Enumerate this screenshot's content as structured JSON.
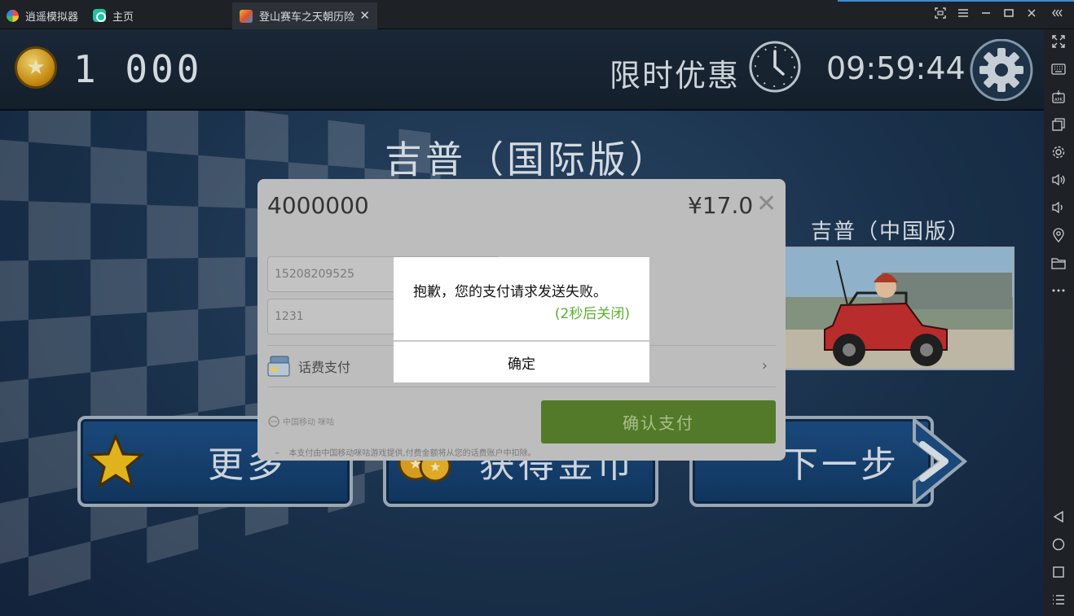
{
  "titlebar": {
    "tabs": [
      {
        "label": "逍遥模拟器"
      },
      {
        "label": "主页"
      },
      {
        "label": "登山赛车之天朝历险"
      }
    ],
    "accent_color": "#3b8fd6"
  },
  "game": {
    "coins": "1 000",
    "offer_label": "限时优惠",
    "countdown": "09:59:44",
    "car_title": "吉普（国际版）",
    "next_car_title": "吉普（中国版）",
    "buttons": {
      "more": "更多",
      "coins": "获得金币",
      "next": "下一步"
    }
  },
  "payment": {
    "product": "4000000",
    "price": "¥17.0",
    "phone_value": "15208209525",
    "code_value": "1231",
    "method_label": "话费支付",
    "logo_text": "中国移动  咪咕",
    "confirm_label": "确认支付",
    "note": "本支付由中国移动咪咕游戏提供,付费金额将从您的话费账户中扣除。",
    "confirm_color": "#537a29"
  },
  "alert": {
    "message": "抱歉，您的支付请求发送失败。",
    "countdown": "(2秒后关闭)",
    "ok_label": "确定",
    "countdown_color": "#5ab02f"
  }
}
